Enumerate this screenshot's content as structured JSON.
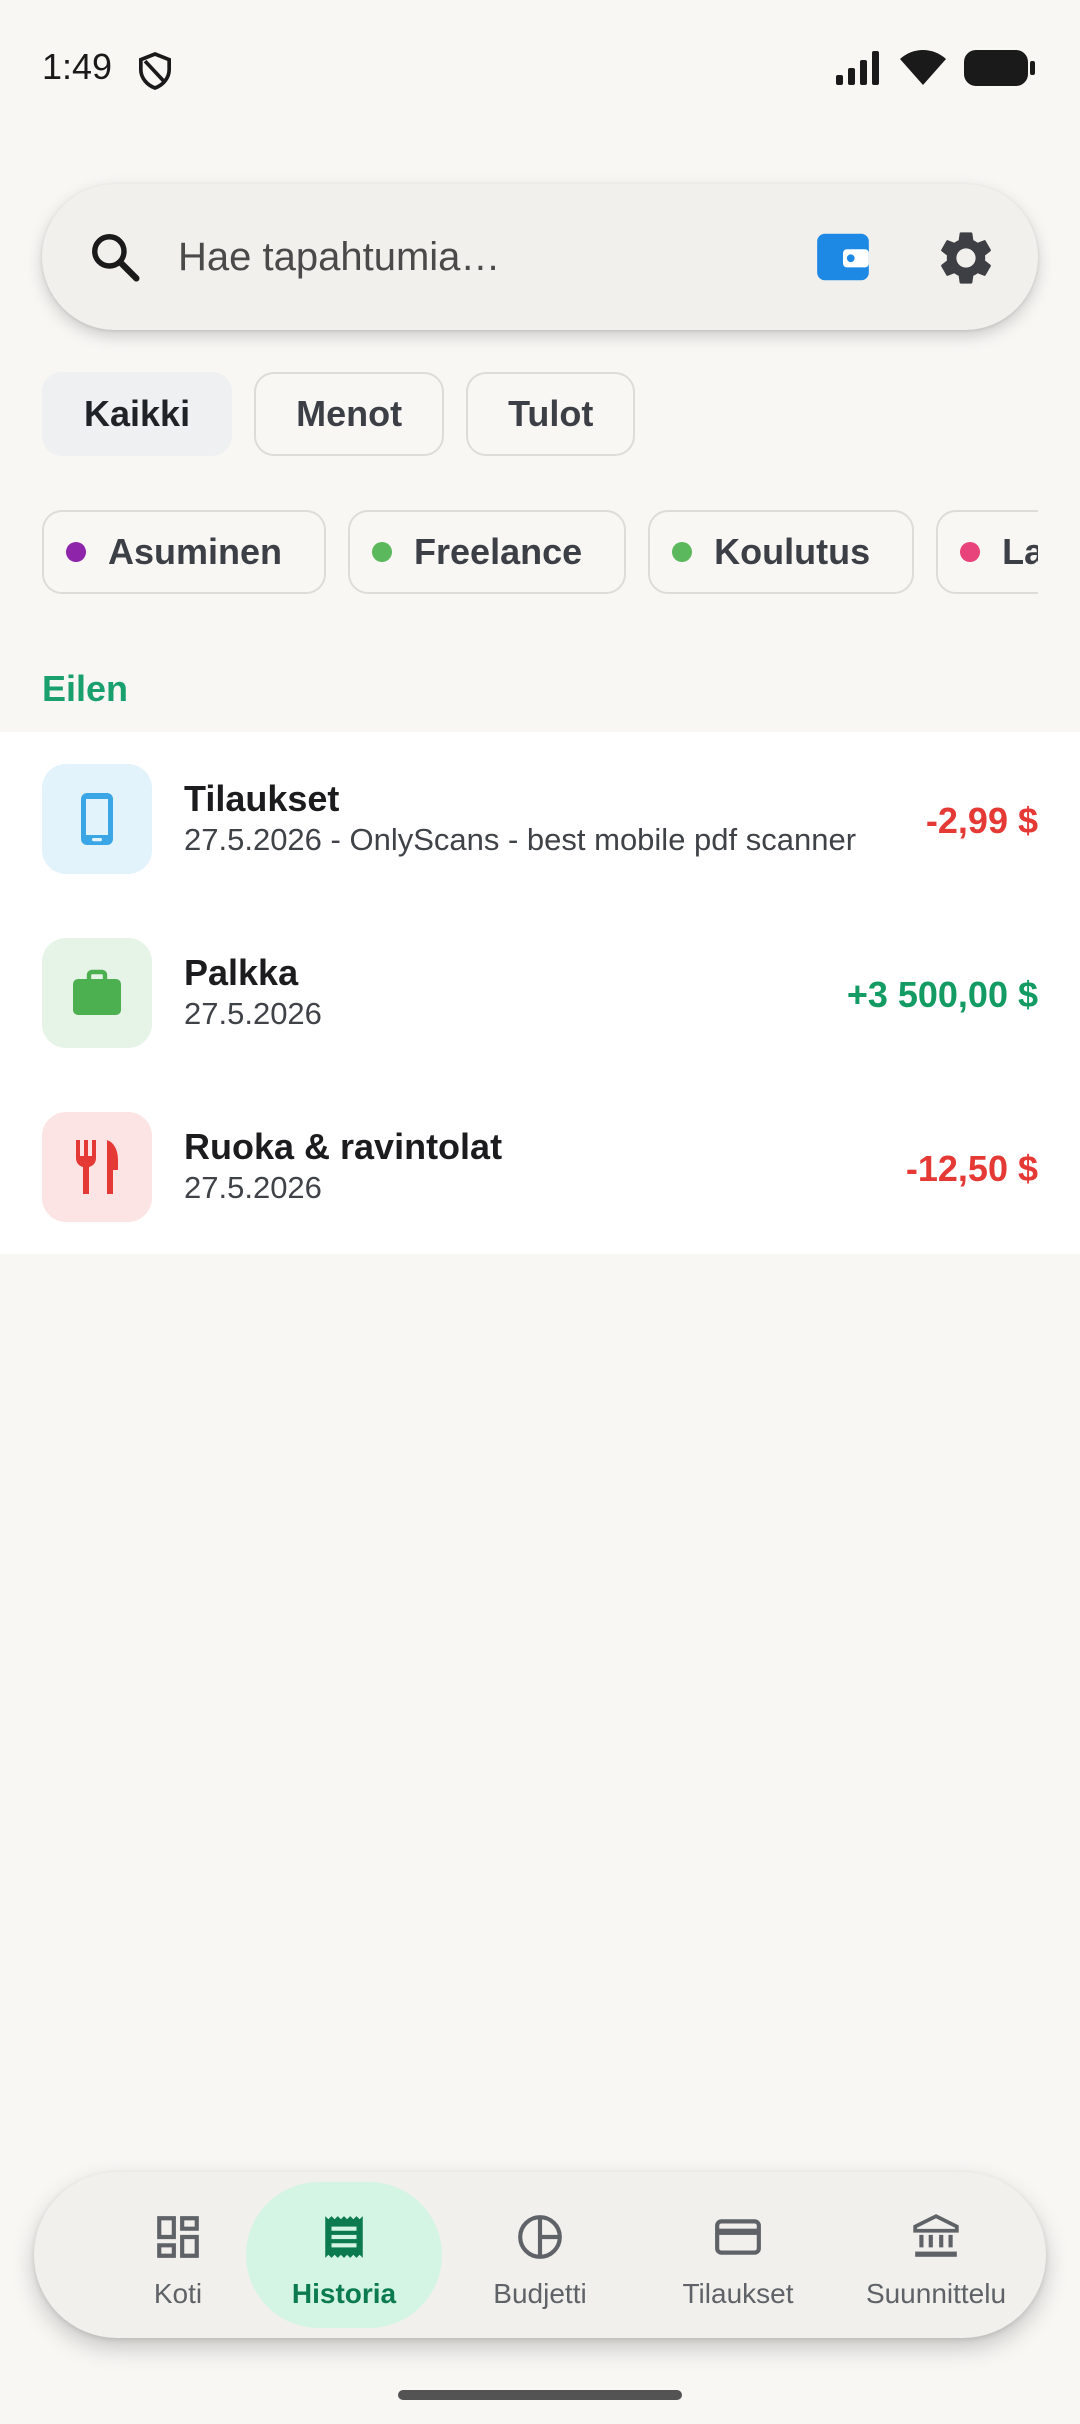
{
  "status": {
    "time": "1:49"
  },
  "search": {
    "placeholder": "Hae tapahtumia…",
    "value": ""
  },
  "type_filters": [
    {
      "label": "Kaikki",
      "active": true
    },
    {
      "label": "Menot",
      "active": false
    },
    {
      "label": "Tulot",
      "active": false
    }
  ],
  "category_filters": [
    {
      "label": "Asuminen",
      "dot_color": "#8e24aa"
    },
    {
      "label": "Freelance",
      "dot_color": "#5cb85c"
    },
    {
      "label": "Koulutus",
      "dot_color": "#5cb85c"
    },
    {
      "label": "Lahjat",
      "dot_color": "#e8437a"
    }
  ],
  "section": {
    "label": "Eilen"
  },
  "transactions": [
    {
      "title": "Tilaukset",
      "subtitle": "27.5.2026 - OnlyScans - best mobile pdf scanner",
      "amount": "-2,99 $",
      "icon": "phone-icon",
      "icon_bg": "#e3f3fc",
      "icon_color": "#3ba6e6",
      "amount_color": "#e53935"
    },
    {
      "title": "Palkka",
      "subtitle": "27.5.2026",
      "amount": "+3 500,00 $",
      "icon": "briefcase-icon",
      "icon_bg": "#e6f3e7",
      "icon_color": "#4caf50",
      "amount_color": "#139b63"
    },
    {
      "title": "Ruoka & ravintolat",
      "subtitle": "27.5.2026",
      "amount": "-12,50 $",
      "icon": "restaurant-icon",
      "icon_bg": "#fde4e4",
      "icon_color": "#e53935",
      "amount_color": "#e53935"
    }
  ],
  "nav": {
    "items": [
      {
        "label": "Koti",
        "icon": "dashboard-icon",
        "active": false
      },
      {
        "label": "Historia",
        "icon": "receipt-icon",
        "active": true
      },
      {
        "label": "Budjetti",
        "icon": "pie-chart-icon",
        "active": false
      },
      {
        "label": "Tilaukset",
        "icon": "credit-card-icon",
        "active": false
      },
      {
        "label": "Suunnittelu",
        "icon": "bank-icon",
        "active": false
      }
    ]
  },
  "colors": {
    "accent": "#1aa06d",
    "wallet_blue": "#1e88e5",
    "expense_red": "#e53935",
    "income_green": "#139b63"
  }
}
